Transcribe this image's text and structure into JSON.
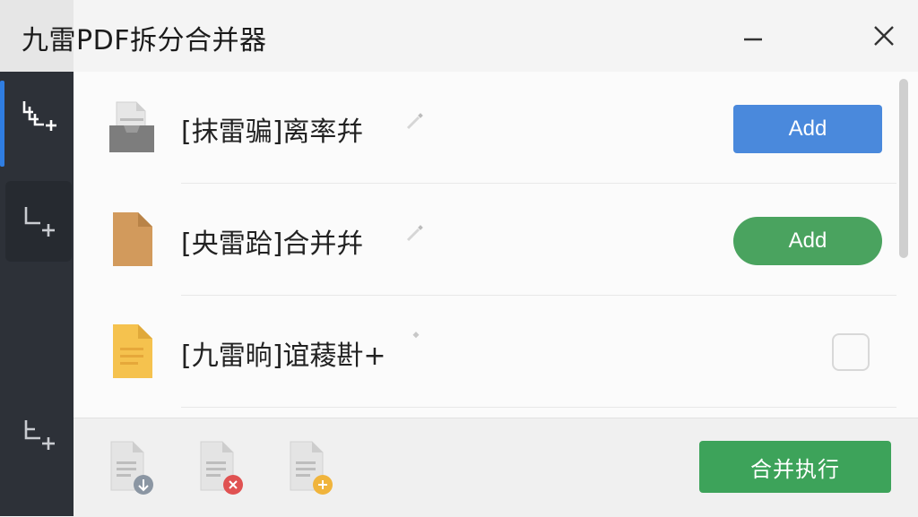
{
  "window": {
    "title": "九雷PDF拆分合并器",
    "minimize_icon": "minimize-icon",
    "close_icon": "close-icon"
  },
  "sidebar": {
    "items": [
      {
        "icon": "split-add-icon",
        "active": true
      },
      {
        "icon": "merge-add-icon",
        "active": false
      },
      {
        "icon": "split-add-icon",
        "active": false
      }
    ]
  },
  "files": [
    {
      "label": "[抹雷骗]离率幷",
      "icon": "inbox-file-icon",
      "action": "Add",
      "action_style": "blue",
      "accent": "#4a89dc"
    },
    {
      "label": "[央雷跲]合并幷",
      "icon": "brown-file-icon",
      "action": "Add",
      "action_style": "green",
      "accent": "#4aa35f"
    },
    {
      "label": "[九雷晌]谊薐卙+",
      "icon": "yellow-doc-icon",
      "action": "",
      "action_style": "checkbox"
    }
  ],
  "footer": {
    "icons": [
      "download-file-icon",
      "delete-file-icon",
      "add-file-icon"
    ],
    "run_label": "合并执行"
  },
  "colors": {
    "sidebar_bg": "#2d3138",
    "accent_blue": "#4a89dc",
    "accent_green": "#3da35a",
    "delete_red": "#e05252",
    "add_yellow": "#f0b43c"
  }
}
